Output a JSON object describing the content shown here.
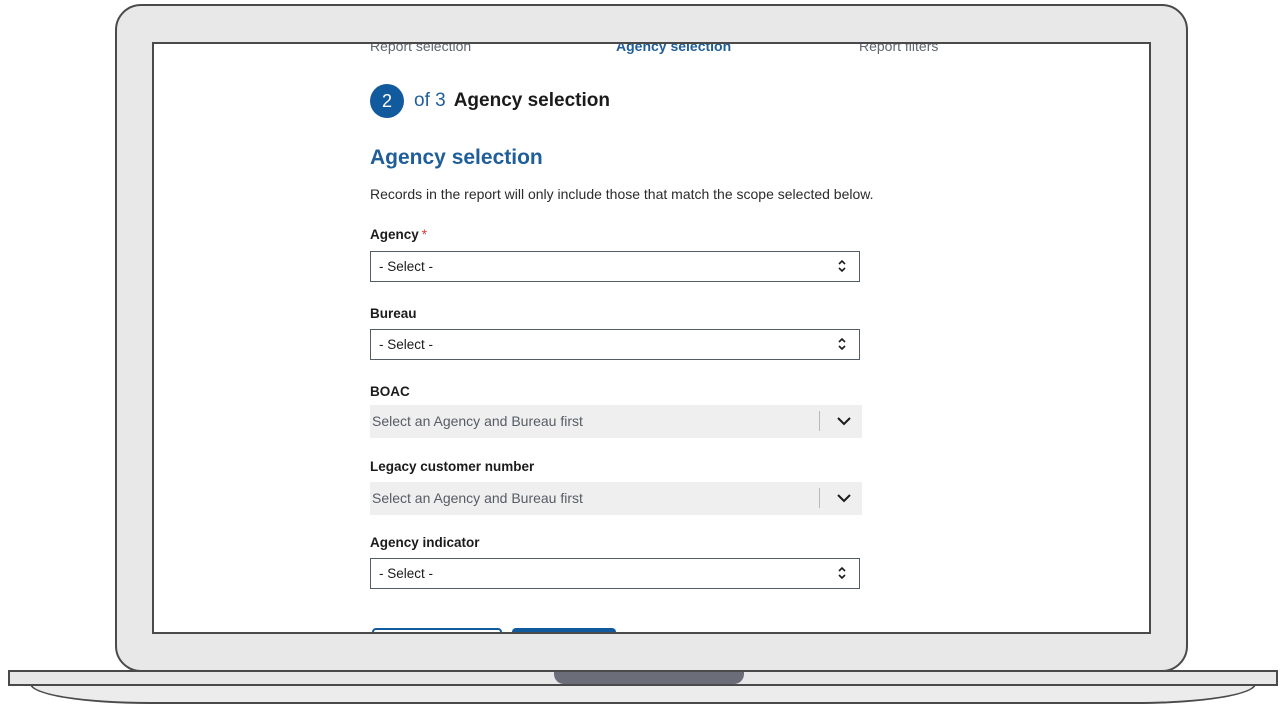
{
  "stepper": {
    "steps": [
      "Report selection",
      "Agency selection",
      "Report filters"
    ],
    "current_number": "2",
    "of_text": "of 3",
    "current_title": "Agency selection"
  },
  "section": {
    "heading": "Agency selection",
    "description": "Records in the report will only include those that match the scope selected below."
  },
  "fields": {
    "agency": {
      "label": "Agency",
      "required_mark": "*",
      "value": "- Select -"
    },
    "bureau": {
      "label": "Bureau",
      "value": "- Select -"
    },
    "boac": {
      "label": "BOAC",
      "placeholder": "Select an Agency and Bureau first"
    },
    "legacy": {
      "label": "Legacy customer number",
      "placeholder": "Select an Agency and Bureau first"
    },
    "agency_indicator": {
      "label": "Agency indicator",
      "value": "- Select -"
    }
  },
  "colors": {
    "primary": "#125a9e",
    "heading_blue": "#1f5e99",
    "required": "#d83933",
    "disabled_bg": "#efefef"
  },
  "icons": {
    "select_caret": "up-down-caret-icon",
    "combo_chevron": "chevron-down-icon"
  }
}
